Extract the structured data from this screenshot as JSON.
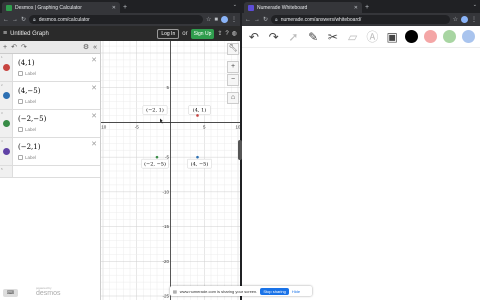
{
  "left_browser": {
    "tab_title": "Desmos | Graphing Calculator",
    "url": "desmos.com/calculator"
  },
  "desmos": {
    "graph_title": "Untitled Graph",
    "login_label": "Log In",
    "signup_label": "Sign Up",
    "expressions": [
      {
        "num": "1",
        "latex": "(4,1)",
        "color": "#c74440",
        "label": "Label"
      },
      {
        "num": "2",
        "latex": "(4,−5)",
        "color": "#2d70b3",
        "label": "Label"
      },
      {
        "num": "3",
        "latex": "(−2,−5)",
        "color": "#388c46",
        "label": "Label"
      },
      {
        "num": "4",
        "latex": "(−2,1)",
        "color": "#6042a6",
        "label": "Label"
      },
      {
        "num": "5",
        "latex": "",
        "color": "",
        "label": ""
      }
    ],
    "powered_by": "powered by",
    "brand": "desmos",
    "graph": {
      "xlim": [
        -10,
        10
      ],
      "ylim": [
        -25,
        10
      ],
      "x_ticks": [
        "-10",
        "-5",
        "5",
        "10"
      ],
      "y_ticks": [
        "5",
        "-5",
        "-10",
        "-15",
        "-20",
        "-25"
      ],
      "points": [
        {
          "x": 4,
          "y": 1,
          "label": "(4, 1)",
          "color": "#c74440"
        },
        {
          "x": 4,
          "y": -5,
          "label": "(4, −5)",
          "color": "#2d70b3"
        },
        {
          "x": -2,
          "y": -5,
          "label": "(−2, −5)",
          "color": "#388c46"
        },
        {
          "x": -2,
          "y": 1,
          "label": "(−2, 1)",
          "color": ""
        }
      ]
    }
  },
  "share_bar": {
    "message": "www.numerade.com is sharing your screen.",
    "stop_label": "Stop sharing",
    "hide_label": "Hide"
  },
  "right_browser": {
    "tab_title": "Numerade Whiteboard",
    "url": "numerade.com/answers/whiteboard/"
  },
  "whiteboard": {
    "swatches": [
      "#000000",
      "#f4a6a6",
      "#a8d5a2",
      "#a9c4ee"
    ]
  }
}
